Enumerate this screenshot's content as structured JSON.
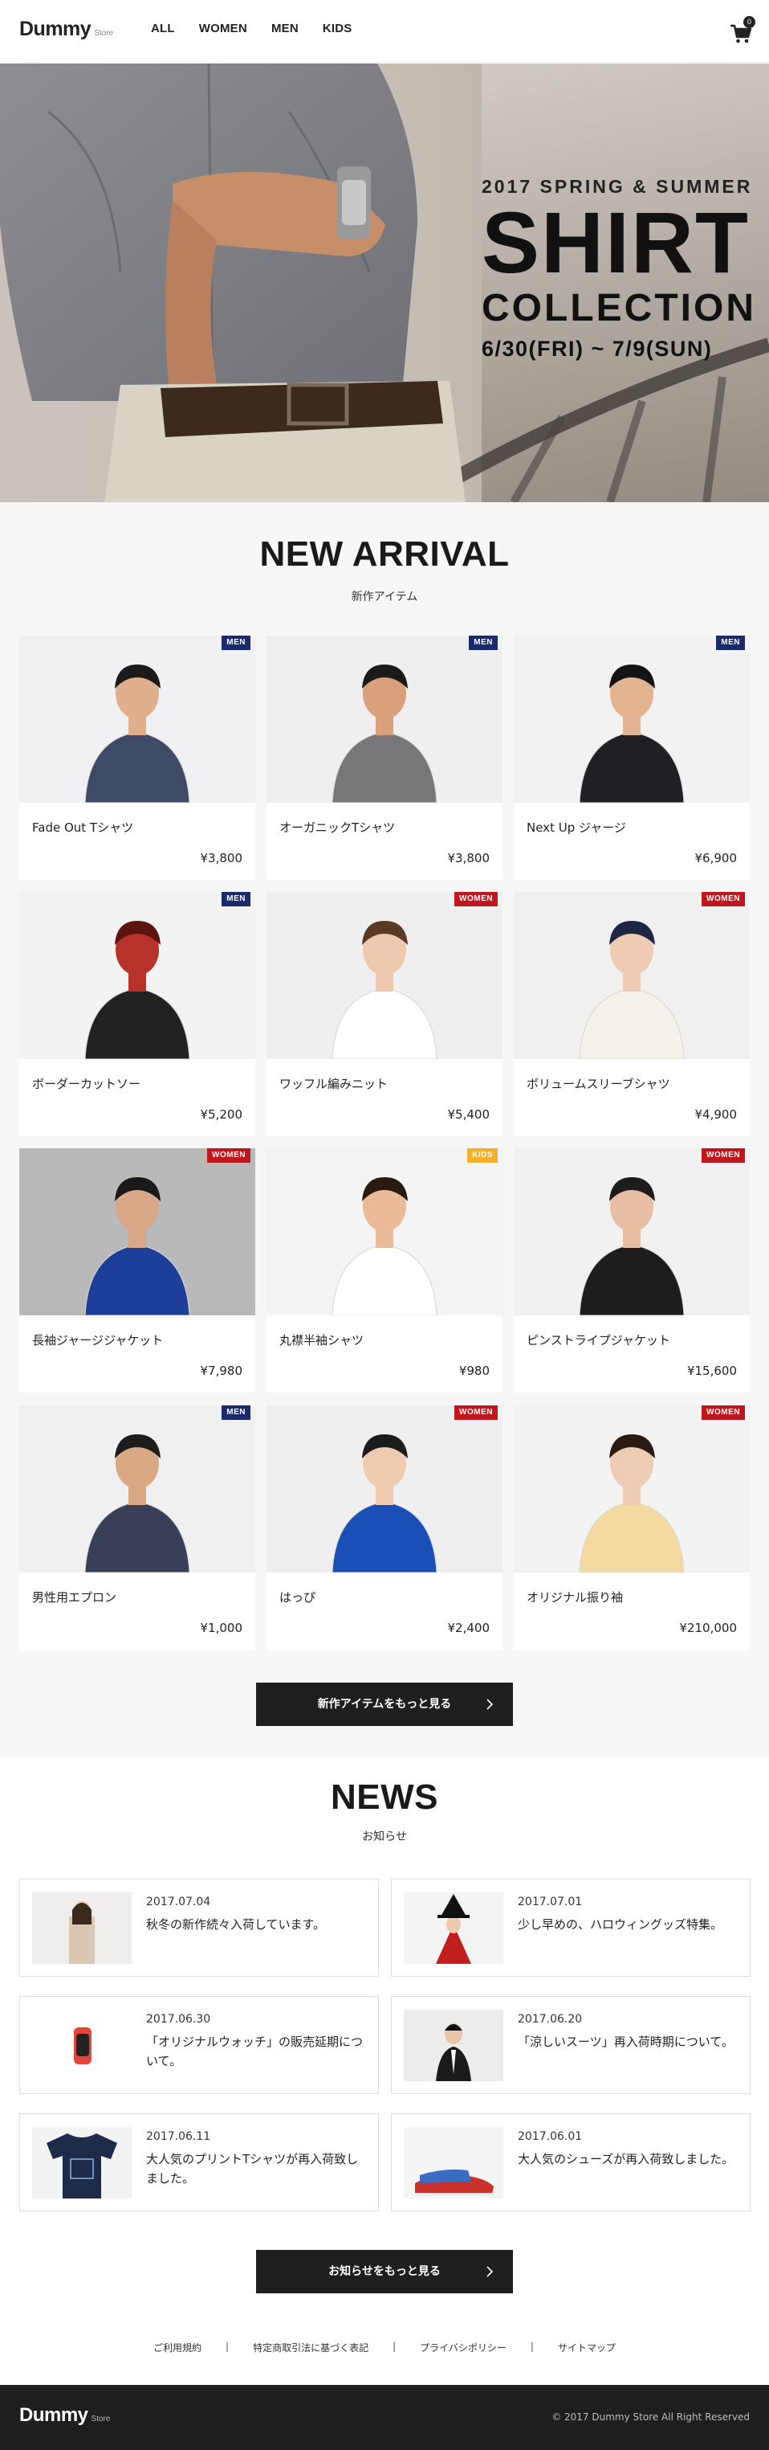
{
  "header": {
    "logo_main": "Dummy",
    "logo_sub": "Store",
    "nav": [
      "ALL",
      "WOMEN",
      "MEN",
      "KIDS"
    ],
    "cart_count": "0"
  },
  "hero": {
    "subtitle": "2017 SPRING & SUMMER",
    "title": "SHIRT",
    "collection": "COLLECTION",
    "dates": "6/30(FRI) ~ 7/9(SUN)"
  },
  "arrivals": {
    "title": "NEW ARRIVAL",
    "subtitle": "新作アイテム",
    "items": [
      {
        "name": "Fade Out Tシャツ",
        "price": "¥3,800",
        "badge": "MEN"
      },
      {
        "name": "オーガニックTシャツ",
        "price": "¥3,800",
        "badge": "MEN"
      },
      {
        "name": "Next Up ジャージ",
        "price": "¥6,900",
        "badge": "MEN"
      },
      {
        "name": "ボーダーカットソー",
        "price": "¥5,200",
        "badge": "MEN"
      },
      {
        "name": "ワッフル編みニット",
        "price": "¥5,400",
        "badge": "WOMEN"
      },
      {
        "name": "ボリュームスリーブシャツ",
        "price": "¥4,900",
        "badge": "WOMEN"
      },
      {
        "name": "長袖ジャージジャケット",
        "price": "¥7,980",
        "badge": "WOMEN"
      },
      {
        "name": "丸襟半袖シャツ",
        "price": "¥980",
        "badge": "KIDS"
      },
      {
        "name": "ピンストライプジャケット",
        "price": "¥15,600",
        "badge": "WOMEN"
      },
      {
        "name": "男性用エプロン",
        "price": "¥1,000",
        "badge": "MEN"
      },
      {
        "name": "はっぴ",
        "price": "¥2,400",
        "badge": "WOMEN"
      },
      {
        "name": "オリジナル振り袖",
        "price": "¥210,000",
        "badge": "WOMEN"
      }
    ],
    "more_label": "新作アイテムをもっと見る"
  },
  "badge_colors": {
    "MEN": "#1b2a6b",
    "WOMEN": "#c0161e",
    "KIDS": "#f3b12d"
  },
  "news": {
    "title": "NEWS",
    "subtitle": "お知らせ",
    "items": [
      {
        "date": "2017.07.04",
        "text": "秋冬の新作続々入荷しています。"
      },
      {
        "date": "2017.07.01",
        "text": "少し早めの、ハロウィングッズ特集。"
      },
      {
        "date": "2017.06.30",
        "text": "「オリジナルウォッチ」の販売延期について。"
      },
      {
        "date": "2017.06.20",
        "text": "「涼しいスーツ」再入荷時期について。"
      },
      {
        "date": "2017.06.11",
        "text": "大人気のプリントTシャツが再入荷致しました。"
      },
      {
        "date": "2017.06.01",
        "text": "大人気のシューズが再入荷致しました。"
      }
    ],
    "more_label": "お知らせをもっと見る"
  },
  "footer": {
    "links": [
      "ご利用規約",
      "特定商取引法に基づく表記",
      "プライバシポリシー",
      "サイトマップ"
    ],
    "logo_main": "Dummy",
    "logo_sub": "Store",
    "copyright": "© 2017 Dummy Store All Right Reserved"
  }
}
